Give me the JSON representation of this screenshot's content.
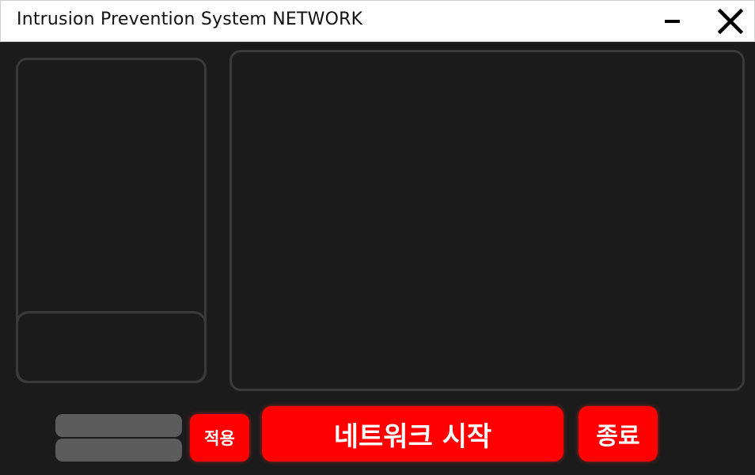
{
  "window": {
    "title": "Intrusion Prevention System NETWORK",
    "minimize_icon": "minimize-icon",
    "close_icon": "close-icon"
  },
  "controls": {
    "apply_label": "적용",
    "start_label": "네트워크 시작",
    "exit_label": "종료"
  },
  "colors": {
    "background": "#1b1b1b",
    "titlebar": "#ffffff",
    "accent": "#ff0000",
    "panel_border": "#3a3a3a",
    "input": "#5c5c5c"
  }
}
